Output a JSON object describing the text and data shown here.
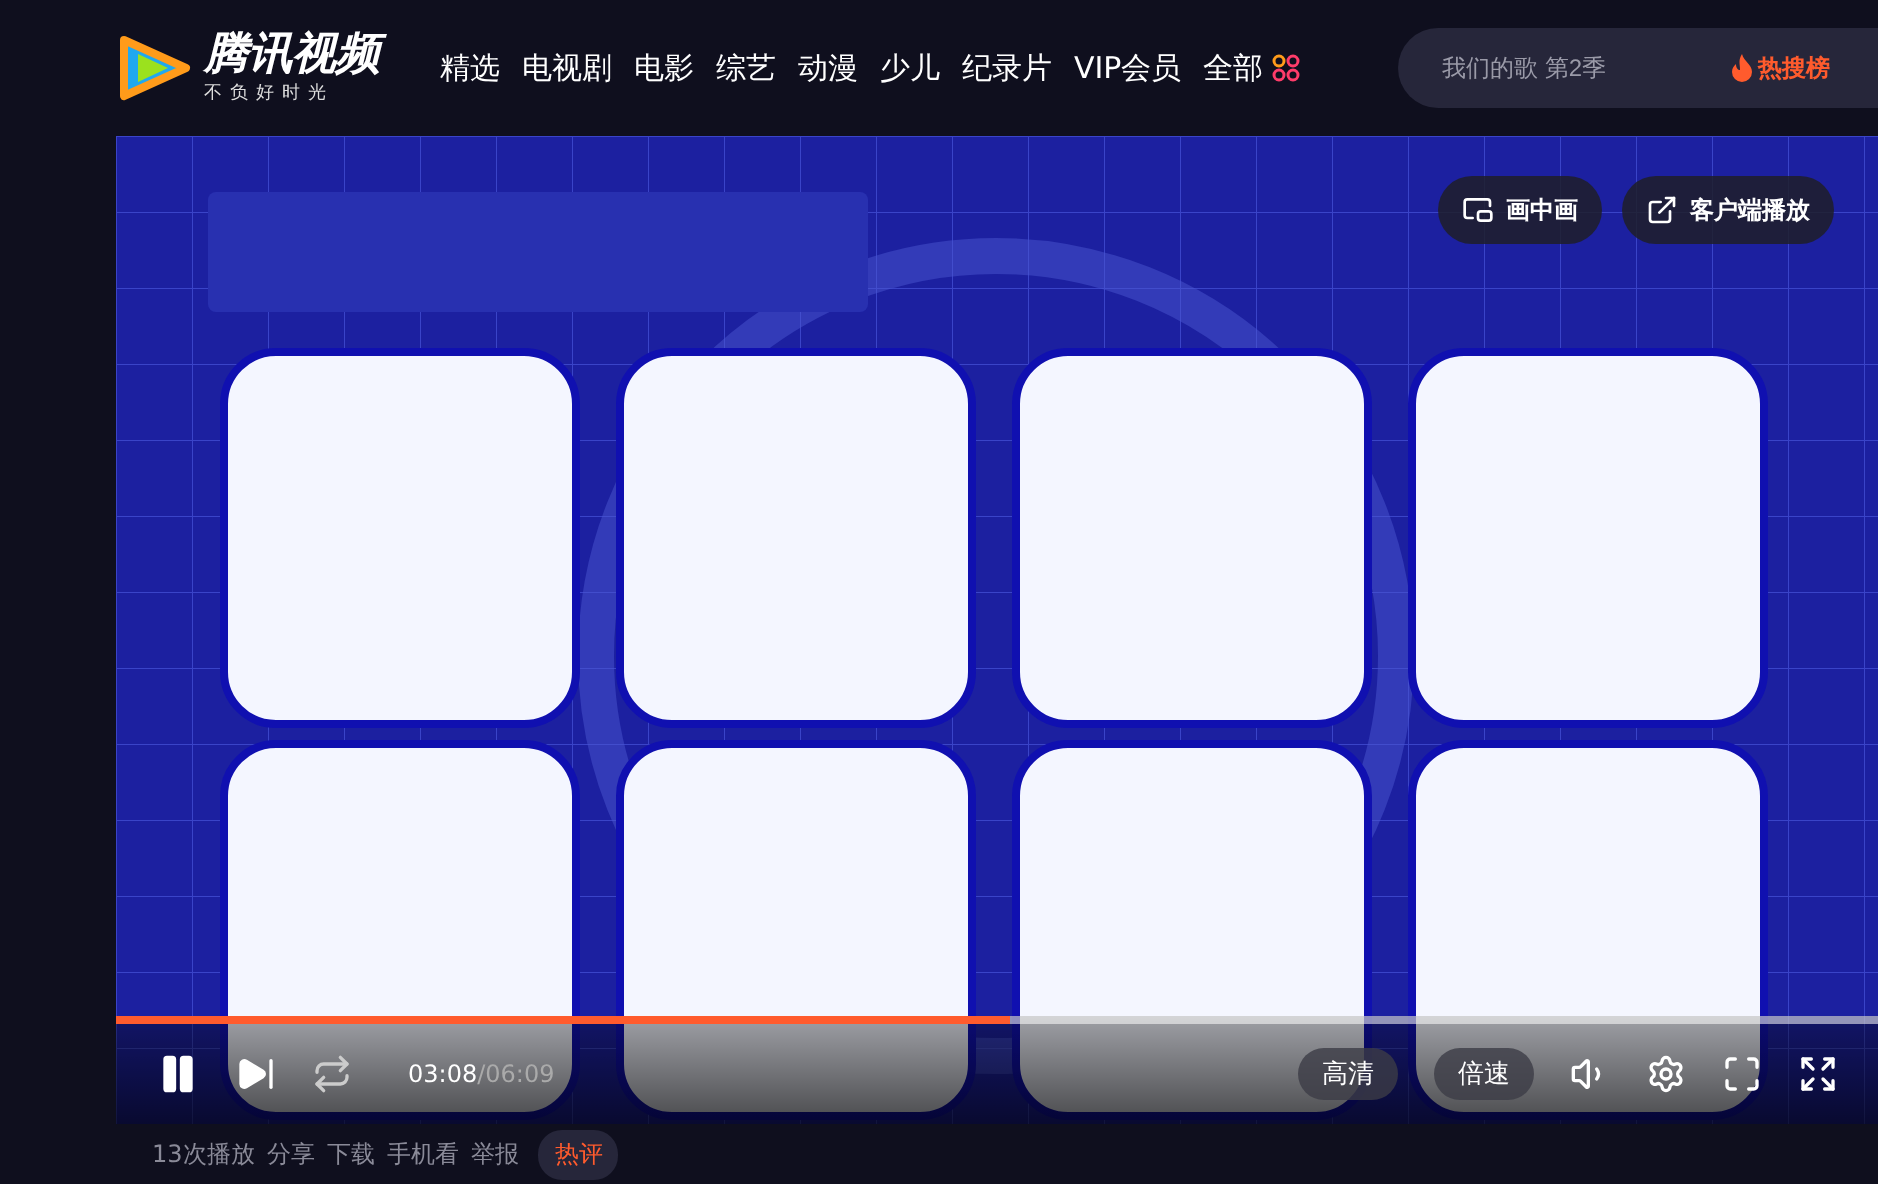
{
  "brand": {
    "name": "腾讯视频",
    "slogan": "不负好时光"
  },
  "nav": [
    {
      "label": "精选"
    },
    {
      "label": "电视剧"
    },
    {
      "label": "电影"
    },
    {
      "label": "综艺"
    },
    {
      "label": "动漫"
    },
    {
      "label": "少儿"
    },
    {
      "label": "纪录片"
    },
    {
      "label": "VIP会员"
    },
    {
      "label": "全部",
      "kind": "more"
    }
  ],
  "search": {
    "placeholder": "我们的歌 第2季"
  },
  "hot_search": "热搜榜",
  "player": {
    "overlay_buttons": [
      {
        "label": "画中画",
        "kind": "pip"
      },
      {
        "label": "客户端播放",
        "kind": "external"
      }
    ],
    "progress": {
      "level": 0.507
    },
    "playing": true,
    "current_time": "03:08",
    "duration": "/06:09",
    "quality": "高清",
    "speed": "倍速"
  },
  "footer": {
    "actions": [
      "13次播放",
      "分享",
      "下载",
      "手机看",
      "举报"
    ],
    "badge": "热评"
  }
}
